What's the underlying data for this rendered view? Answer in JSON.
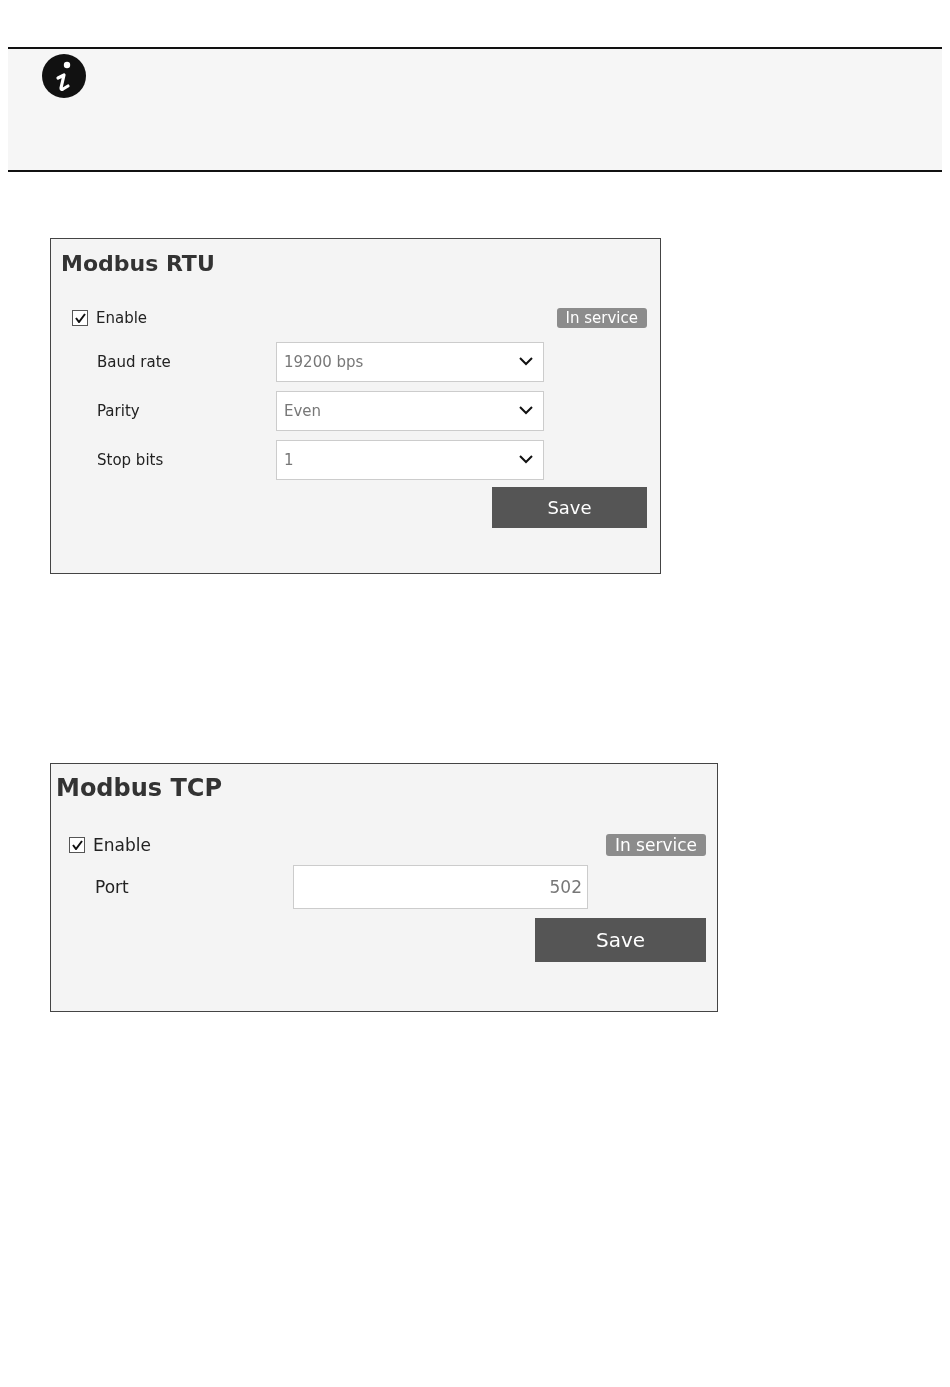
{
  "panels": [
    {
      "title": "Modbus RTU",
      "enable": {
        "label": "Enable",
        "checked": true
      },
      "status": "In service",
      "fields": [
        {
          "kind": "select",
          "label": "Baud rate",
          "value": "19200 bps"
        },
        {
          "kind": "select",
          "label": "Parity",
          "value": "Even"
        },
        {
          "kind": "select",
          "label": "Stop bits",
          "value": "1"
        }
      ],
      "save": "Save"
    },
    {
      "title": "Modbus TCP",
      "enable": {
        "label": "Enable",
        "checked": true
      },
      "status": "In service",
      "fields": [
        {
          "kind": "text",
          "label": "Port",
          "value": "502"
        }
      ],
      "save": "Save"
    }
  ]
}
